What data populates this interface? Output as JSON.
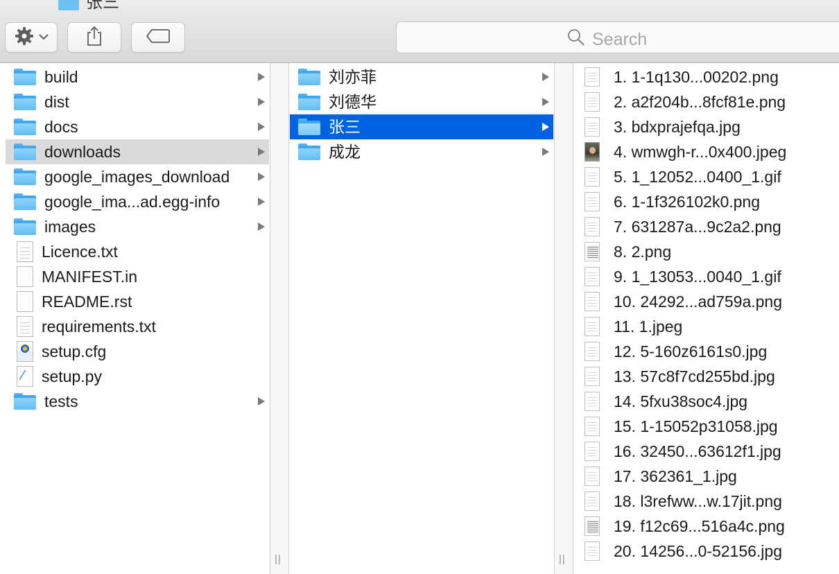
{
  "window": {
    "title": "张三"
  },
  "toolbar": {
    "action_icon": "gear-icon",
    "share_icon": "share-icon",
    "tags_icon": "tag-icon",
    "search_placeholder": "Search"
  },
  "columns": {
    "col1": [
      {
        "label": "build",
        "kind": "folder",
        "arrow": true
      },
      {
        "label": "dist",
        "kind": "folder",
        "arrow": true
      },
      {
        "label": "docs",
        "kind": "folder",
        "arrow": true
      },
      {
        "label": "downloads",
        "kind": "folder",
        "arrow": true,
        "state": "highlighted"
      },
      {
        "label": "google_images_download",
        "kind": "folder",
        "arrow": true
      },
      {
        "label": "google_ima...ad.egg-info",
        "kind": "folder",
        "arrow": true
      },
      {
        "label": "images",
        "kind": "folder",
        "arrow": true
      },
      {
        "label": "Licence.txt",
        "kind": "text-file"
      },
      {
        "label": "MANIFEST.in",
        "kind": "blank-file"
      },
      {
        "label": "README.rst",
        "kind": "blank-file"
      },
      {
        "label": "requirements.txt",
        "kind": "text-file"
      },
      {
        "label": "setup.cfg",
        "kind": "cfg-file"
      },
      {
        "label": "setup.py",
        "kind": "python-file"
      },
      {
        "label": "tests",
        "kind": "folder",
        "arrow": true
      }
    ],
    "col2": [
      {
        "label": "刘亦菲",
        "kind": "folder",
        "arrow": true
      },
      {
        "label": "刘德华",
        "kind": "folder",
        "arrow": true
      },
      {
        "label": "张三",
        "kind": "folder",
        "arrow": true,
        "state": "selected"
      },
      {
        "label": "成龙",
        "kind": "folder",
        "arrow": true
      }
    ],
    "col3": [
      {
        "label": "1. 1-1q130...00202.png",
        "thumb": "lines"
      },
      {
        "label": "2. a2f204b...8fcf81e.png",
        "thumb": "lines"
      },
      {
        "label": "3. bdxprajefqa.jpg",
        "thumb": "lines"
      },
      {
        "label": "4. wmwgh-r...0x400.jpeg",
        "thumb": "photo"
      },
      {
        "label": "5. 1_12052...0400_1.gif",
        "thumb": "lines"
      },
      {
        "label": "6. 1-1f326102k0.png",
        "thumb": "lines"
      },
      {
        "label": "7. 631287a...9c2a2.png",
        "thumb": "lines"
      },
      {
        "label": "8. 2.png",
        "thumb": "dark"
      },
      {
        "label": "9. 1_13053...0040_1.gif",
        "thumb": "lines"
      },
      {
        "label": "10. 24292...ad759a.png",
        "thumb": "lines"
      },
      {
        "label": "11. 1.jpeg",
        "thumb": "lines"
      },
      {
        "label": "12. 5-160z6161s0.jpg",
        "thumb": "lines"
      },
      {
        "label": "13. 57c8f7cd255bd.jpg",
        "thumb": "lines"
      },
      {
        "label": "14. 5fxu38soc4.jpg",
        "thumb": "lines"
      },
      {
        "label": "15. 1-15052p31058.jpg",
        "thumb": "lines"
      },
      {
        "label": "16. 32450...63612f1.jpg",
        "thumb": "lines"
      },
      {
        "label": "17. 362361_1.jpg",
        "thumb": "lines"
      },
      {
        "label": "18. l3refww...w.17jit.png",
        "thumb": "lines"
      },
      {
        "label": "19. f12c69...516a4c.png",
        "thumb": "dark"
      },
      {
        "label": "20. 14256...0-52156.jpg",
        "thumb": "lines"
      }
    ]
  },
  "colors": {
    "selection": "#0063e1",
    "highlight": "#dadada",
    "folder": "#60bdf6"
  },
  "grip_label": "||"
}
